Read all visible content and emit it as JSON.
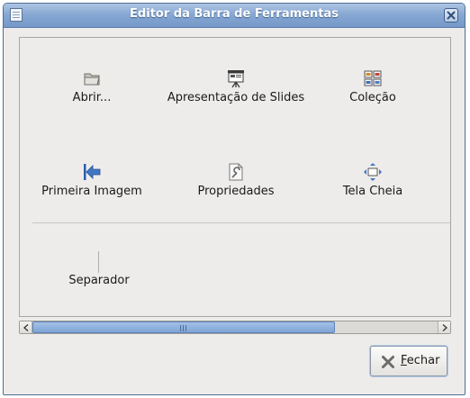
{
  "window": {
    "title": "Editor da Barra de Ferramentas"
  },
  "toolbar_items": [
    {
      "label": "Abrir...",
      "icon": "folder-open-icon"
    },
    {
      "label": "Apresentação de Slides",
      "icon": "slideshow-icon"
    },
    {
      "label": "Coleção",
      "icon": "collection-icon"
    },
    {
      "label": "Primeira Imagem",
      "icon": "first-image-icon"
    },
    {
      "label": "Propriedades",
      "icon": "properties-icon"
    },
    {
      "label": "Tela Cheia",
      "icon": "fullscreen-icon"
    }
  ],
  "separator_item": {
    "label": "Separador"
  },
  "close_button": {
    "mnemonic": "F",
    "rest": "echar",
    "icon": "close-x-icon"
  },
  "colors": {
    "titlebar": "#88a8d3",
    "accent": "#7fa4d6",
    "window_bg": "#edeceb"
  }
}
